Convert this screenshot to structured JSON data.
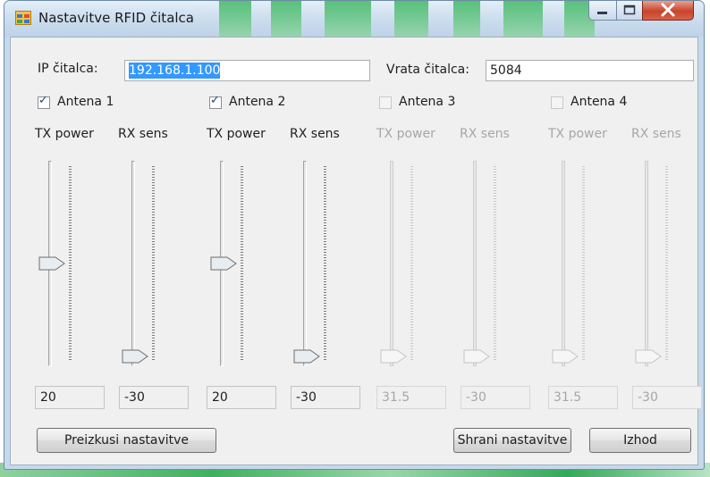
{
  "window": {
    "title": "Nastavitve RFID čitalca",
    "controls": [
      "minimize-icon",
      "maximize-icon",
      "close-icon"
    ]
  },
  "connection": {
    "ip_label": "IP čitalca:",
    "ip_value": "192.168.1.100",
    "port_label": "Vrata čitalca:",
    "port_value": "5084"
  },
  "antennas": [
    {
      "label": "Antena 1",
      "checked": true,
      "enabled": true,
      "tx_label": "TX power",
      "rx_label": "RX sens",
      "tx_value": "20",
      "rx_value": "-30",
      "tx_level": 0.5,
      "rx_level": 0.0
    },
    {
      "label": "Antena 2",
      "checked": true,
      "enabled": true,
      "tx_label": "TX power",
      "rx_label": "RX sens",
      "tx_value": "20",
      "rx_value": "-30",
      "tx_level": 0.5,
      "rx_level": 0.0
    },
    {
      "label": "Antena 3",
      "checked": false,
      "enabled": false,
      "tx_label": "TX power",
      "rx_label": "RX sens",
      "tx_value": "31.5",
      "rx_value": "-30",
      "tx_level": 0.0,
      "rx_level": 0.0
    },
    {
      "label": "Antena 4",
      "checked": false,
      "enabled": false,
      "tx_label": "TX power",
      "rx_label": "RX sens",
      "tx_value": "31.5",
      "rx_value": "-30",
      "tx_level": 0.0,
      "rx_level": 0.0
    }
  ],
  "buttons": {
    "test": "Preizkusi nastavitve",
    "save": "Shrani nastavitve",
    "exit": "Izhod"
  },
  "colors": {
    "selection": "#3399ff",
    "window_frame": "#c6d9ec",
    "close_button": "#c8442c",
    "disabled_text": "#a6a6a6"
  }
}
